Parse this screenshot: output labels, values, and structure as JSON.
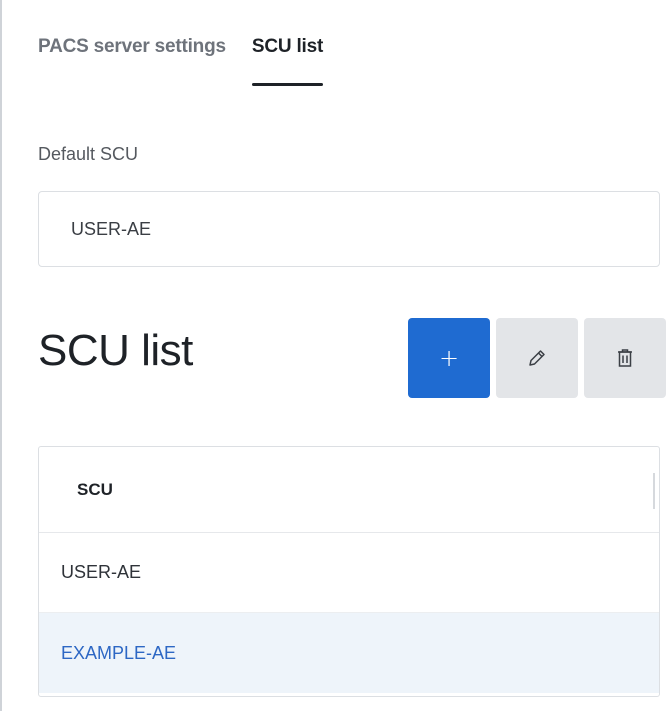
{
  "tabs": [
    {
      "label": "PACS server settings",
      "active": false
    },
    {
      "label": "SCU list",
      "active": true
    }
  ],
  "default_scu": {
    "label": "Default SCU",
    "value": "USER-AE"
  },
  "scu_section": {
    "title": "SCU list",
    "toolbar": [
      {
        "icon": "plus-icon",
        "text": "+"
      },
      {
        "icon": "pencil-icon"
      },
      {
        "icon": "trash-icon"
      }
    ]
  },
  "table": {
    "columns": [
      "SCU"
    ],
    "rows": [
      {
        "scu": "USER-AE",
        "selected": false
      },
      {
        "scu": "EXAMPLE-AE",
        "selected": true
      }
    ]
  },
  "colors": {
    "accent": "#1f6bd1",
    "selected_row_bg": "#eef4fa",
    "selected_row_text": "#2d67c4",
    "secondary_button": "#e3e5e8"
  }
}
